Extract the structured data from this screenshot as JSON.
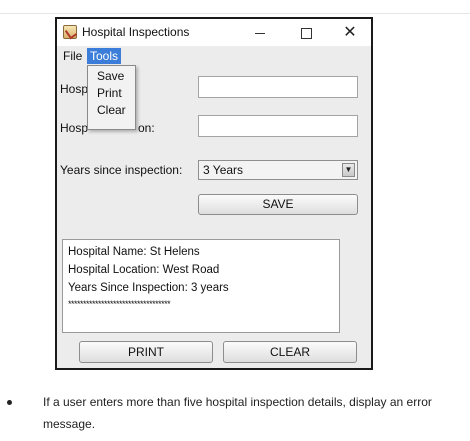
{
  "window": {
    "title": "Hospital Inspections",
    "close_glyph": "✕"
  },
  "menubar": {
    "file": "File",
    "tools": "Tools"
  },
  "tools_menu": {
    "items": [
      "Save",
      "Print",
      "Clear"
    ]
  },
  "form": {
    "name_label_visible": "Hosp",
    "location_label_left": "Hosp",
    "location_label_right": "on:",
    "name_value": "",
    "location_value": "",
    "years_label": "Years since inspection:",
    "years_selected": "3 Years",
    "save_button": "SAVE"
  },
  "output": {
    "lines": [
      "Hospital Name: St Helens",
      "Hospital Location: West Road",
      "Years Since Inspection: 3 years",
      "**********************************"
    ]
  },
  "bottom_buttons": {
    "print": "PRINT",
    "clear": "CLEAR"
  },
  "document": {
    "bullet_text": "If a user enters more than five hospital inspection details, display an error message."
  }
}
